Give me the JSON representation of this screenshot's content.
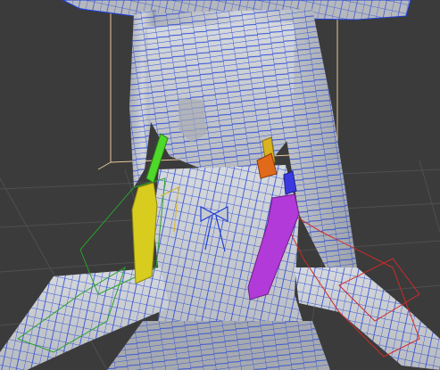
{
  "viewport": {
    "background": "#3b3b3b",
    "grid_color": "#4f4f4f",
    "mesh_fill": "#c9ccd0",
    "wire_color": "#1e3fd6",
    "bbox_color": "#e8c79a"
  },
  "bones": {
    "left_chain_colors": [
      "#4dd82a",
      "#d8cc1e"
    ],
    "right_chain_colors": [
      "#d8b41e",
      "#e06a1a",
      "#3a3ae0",
      "#b23ad8"
    ],
    "rig_left_color": "#2aa02a",
    "rig_right_color": "#d02a2a"
  },
  "icons": [
    "ribbon-bow-icon"
  ]
}
